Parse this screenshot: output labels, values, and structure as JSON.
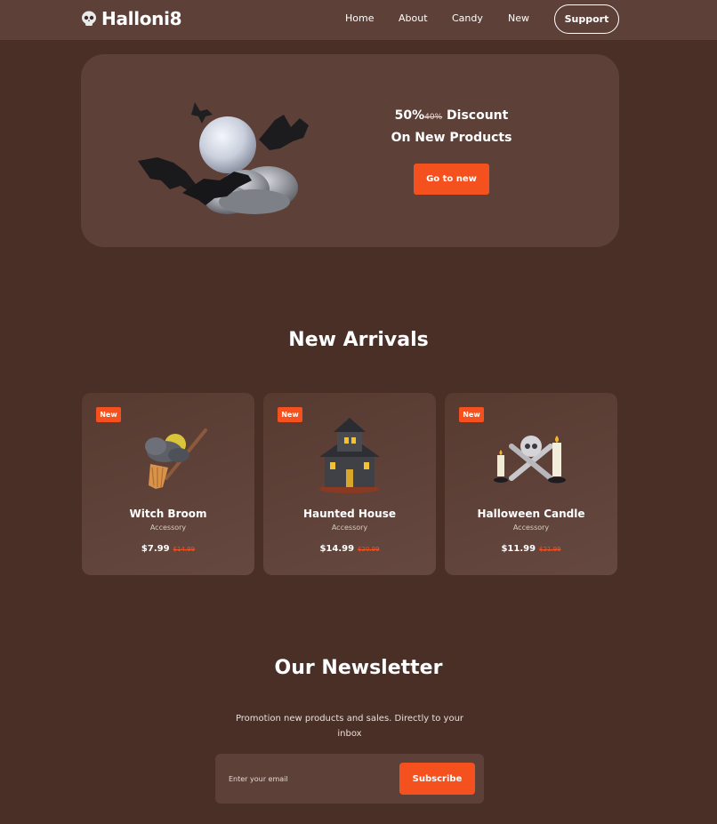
{
  "header": {
    "logo_text": "Halloni8",
    "logo_icon": "skull-icon",
    "nav": [
      "Home",
      "About",
      "Candy",
      "New"
    ],
    "support_label": "Support"
  },
  "hero": {
    "headline_discount": "50%",
    "headline_old": "40%",
    "headline_discount_word": "Discount",
    "headline_line2": "On New Products",
    "button_label": "Go to new",
    "illustration": "moon-bats-clouds-illustration"
  },
  "arrivals": {
    "title": "New Arrivals",
    "products": [
      {
        "badge": "New",
        "name": "Witch Broom",
        "category": "Accessory",
        "price": "$7.99",
        "old_price": "$14.99",
        "image": "witch-broom-image"
      },
      {
        "badge": "New",
        "name": "Haunted House",
        "category": "Accessory",
        "price": "$14.99",
        "old_price": "$20.99",
        "image": "haunted-house-image"
      },
      {
        "badge": "New",
        "name": "Halloween Candle",
        "category": "Accessory",
        "price": "$11.99",
        "old_price": "$21.99",
        "image": "halloween-candle-image"
      }
    ]
  },
  "newsletter": {
    "title": "Our Newsletter",
    "description": "Promotion new products and sales. Directly to your inbox",
    "input_placeholder": "Enter your email",
    "button_label": "Subscribe"
  },
  "colors": {
    "background": "#4a2f27",
    "surface": "#5d4037",
    "accent": "#f4511e",
    "text": "#ffffff"
  }
}
